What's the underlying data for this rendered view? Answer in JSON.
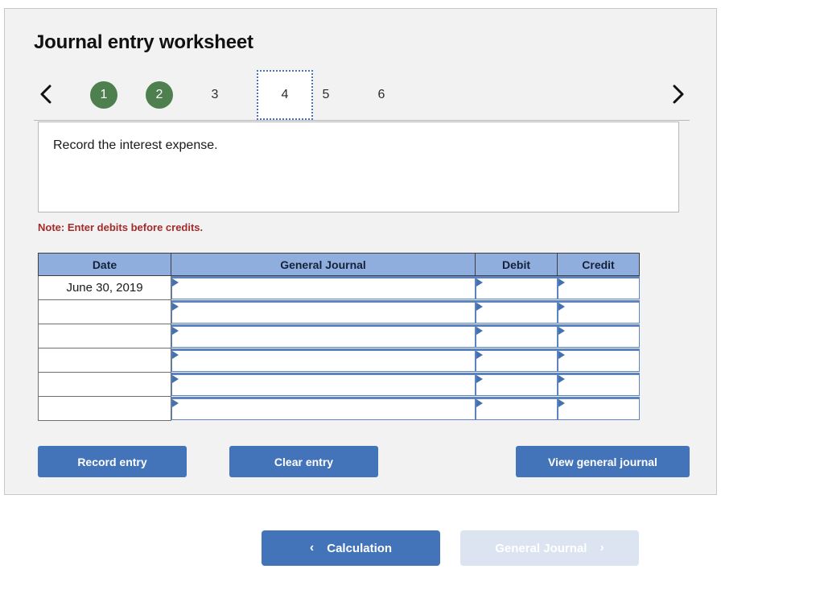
{
  "panel": {
    "title": "Journal entry worksheet"
  },
  "pager": {
    "prev_icon": "chevron-left-icon",
    "next_icon": "chevron-right-icon",
    "steps": [
      {
        "label": "1",
        "state": "done"
      },
      {
        "label": "2",
        "state": "done"
      },
      {
        "label": "3",
        "state": "idle"
      },
      {
        "label": "4",
        "state": "current"
      },
      {
        "label": "5",
        "state": "idle"
      },
      {
        "label": "6",
        "state": "idle"
      }
    ],
    "done_color": "#4e7f4e",
    "current_border_color": "#4472c4"
  },
  "description": {
    "text": "Record the interest expense."
  },
  "note": {
    "text": "Note: Enter debits before credits.",
    "color": "#a32b2b"
  },
  "table": {
    "headers": [
      "Date",
      "General Journal",
      "Debit",
      "Credit"
    ],
    "header_bg": "#8faedd",
    "rows": [
      {
        "date": "June 30, 2019",
        "general_journal": "",
        "debit": "",
        "credit": ""
      },
      {
        "date": "",
        "general_journal": "",
        "debit": "",
        "credit": ""
      },
      {
        "date": "",
        "general_journal": "",
        "debit": "",
        "credit": ""
      },
      {
        "date": "",
        "general_journal": "",
        "debit": "",
        "credit": ""
      },
      {
        "date": "",
        "general_journal": "",
        "debit": "",
        "credit": ""
      },
      {
        "date": "",
        "general_journal": "",
        "debit": "",
        "credit": ""
      }
    ]
  },
  "actions": {
    "record_label": "Record entry",
    "clear_label": "Clear entry",
    "view_label": "View general journal",
    "button_color": "#4373b8"
  },
  "nav": {
    "prev_label": "Calculation",
    "prev_chevron": "‹",
    "next_label": "General Journal",
    "next_chevron": "›",
    "next_disabled_color": "#dbe4f0"
  }
}
